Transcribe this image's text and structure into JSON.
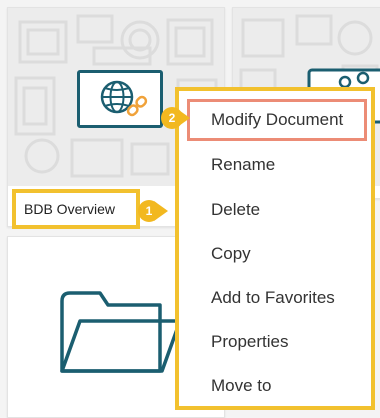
{
  "cards": [
    {
      "title": "BDB Overview",
      "icon": "globe-link-icon"
    },
    {
      "icon": "share-icon"
    },
    {
      "icon": "folder-icon"
    }
  ],
  "steps": [
    {
      "number": "1"
    },
    {
      "number": "2"
    }
  ],
  "context_menu": {
    "items": [
      {
        "label": "Modify Document",
        "highlighted": true
      },
      {
        "label": "Rename"
      },
      {
        "label": "Delete"
      },
      {
        "label": "Copy"
      },
      {
        "label": "Add to Favorites"
      },
      {
        "label": "Properties"
      },
      {
        "label": "Move to"
      }
    ]
  },
  "colors": {
    "callout_yellow": "#f2c12e",
    "badge": "#f2b81f",
    "highlight_border": "#ec8c76",
    "icon_teal": "#1b5e70",
    "icon_orange": "#f0a23a"
  }
}
